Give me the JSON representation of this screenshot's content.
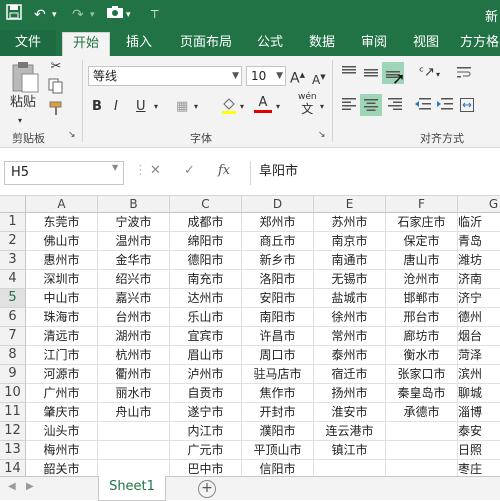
{
  "title_fragment": "新",
  "tabs": [
    "文件",
    "开始",
    "插入",
    "页面布局",
    "公式",
    "数据",
    "审阅",
    "视图",
    "方方格"
  ],
  "ribbon": {
    "paste_label": "粘贴",
    "clipboard_group": "剪贴板",
    "font_group": "字体",
    "alignment_group": "对齐方式",
    "font_name": "等线",
    "font_size": "10",
    "grow_font": "A",
    "shrink_font": "A",
    "bold": "B",
    "italic": "I",
    "underline": "U",
    "font_color_glyph": "A",
    "phonetic_glyph": "wén",
    "phonetic_char": "文"
  },
  "formula_bar": {
    "name_box": "H5",
    "fx": "fx",
    "content": "阜阳市"
  },
  "grid": {
    "columns": [
      "A",
      "B",
      "C",
      "D",
      "E",
      "F",
      "G"
    ],
    "rows": [
      "1",
      "2",
      "3",
      "4",
      "5",
      "6",
      "7",
      "8",
      "9",
      "10",
      "11",
      "12",
      "13",
      "14"
    ],
    "selected_row": "5",
    "cells": [
      [
        "东莞市",
        "宁波市",
        "成都市",
        "郑州市",
        "苏州市",
        "石家庄市",
        "临沂"
      ],
      [
        "佛山市",
        "温州市",
        "绵阳市",
        "商丘市",
        "南京市",
        "保定市",
        "青岛"
      ],
      [
        "惠州市",
        "金华市",
        "德阳市",
        "新乡市",
        "南通市",
        "唐山市",
        "潍坊"
      ],
      [
        "深圳市",
        "绍兴市",
        "南充市",
        "洛阳市",
        "无锡市",
        "沧州市",
        "济南"
      ],
      [
        "中山市",
        "嘉兴市",
        "达州市",
        "安阳市",
        "盐城市",
        "邯郸市",
        "济宁"
      ],
      [
        "珠海市",
        "台州市",
        "乐山市",
        "南阳市",
        "徐州市",
        "邢台市",
        "德州"
      ],
      [
        "清远市",
        "湖州市",
        "宜宾市",
        "许昌市",
        "常州市",
        "廊坊市",
        "烟台"
      ],
      [
        "江门市",
        "杭州市",
        "眉山市",
        "周口市",
        "泰州市",
        "衡水市",
        "菏泽"
      ],
      [
        "河源市",
        "衢州市",
        "泸州市",
        "驻马店市",
        "宿迁市",
        "张家口市",
        "滨州"
      ],
      [
        "广州市",
        "丽水市",
        "自贡市",
        "焦作市",
        "扬州市",
        "秦皇岛市",
        "聊城"
      ],
      [
        "肇庆市",
        "舟山市",
        "遂宁市",
        "开封市",
        "淮安市",
        "承德市",
        "淄博"
      ],
      [
        "汕头市",
        "",
        "内江市",
        "濮阳市",
        "连云港市",
        "",
        "泰安"
      ],
      [
        "梅州市",
        "",
        "广元市",
        "平顶山市",
        "镇江市",
        "",
        "日照"
      ],
      [
        "韶关市",
        "",
        "巴中市",
        "信阳市",
        "",
        "",
        "枣庄"
      ]
    ]
  },
  "sheets": {
    "active": "Sheet1",
    "add_symbol": "+"
  }
}
